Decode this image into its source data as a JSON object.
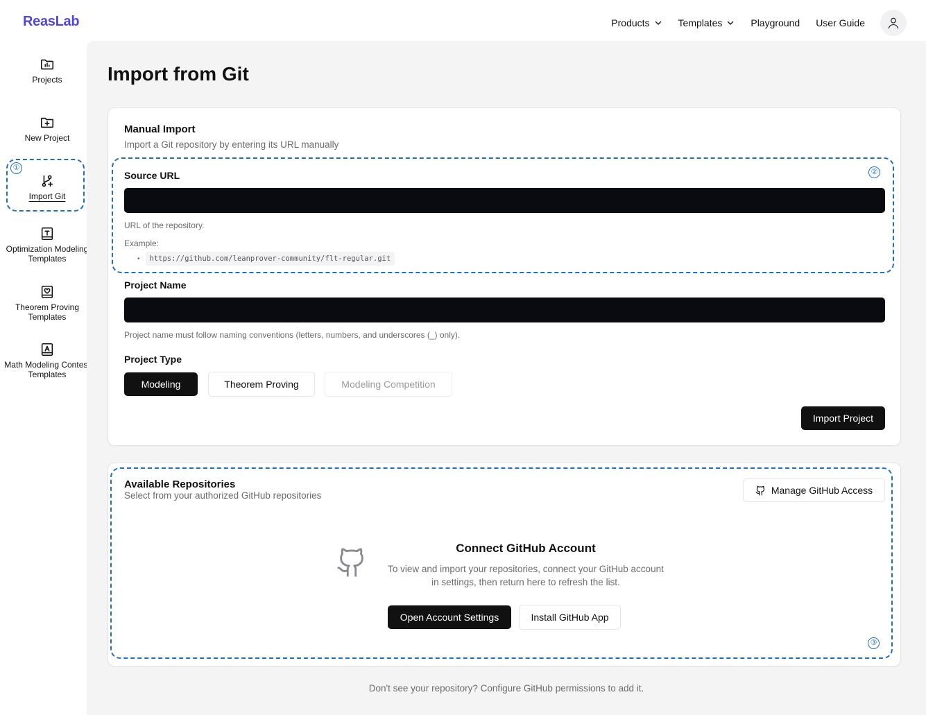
{
  "brand": {
    "logo": "ReasLab",
    "color": "#5147e0"
  },
  "topnav": {
    "products": "Products",
    "templates": "Templates",
    "playground": "Playground",
    "user_guide": "User Guide"
  },
  "sidebar": {
    "items": [
      {
        "label": "Projects",
        "icon": "folder-chart-icon"
      },
      {
        "label": "New Project",
        "icon": "folder-plus-icon"
      },
      {
        "label": "Import Git",
        "icon": "git-branch-plus-icon",
        "active": true
      },
      {
        "label": "Optimization Modeling Templates",
        "icon": "book-text-icon"
      },
      {
        "label": "Theorem Proving Templates",
        "icon": "book-heart-icon"
      },
      {
        "label": "Math Modeling Contest Templates",
        "icon": "book-a-icon"
      }
    ]
  },
  "annotations": {
    "one": "①",
    "two": "②",
    "three": "③"
  },
  "page": {
    "title": "Import from Git"
  },
  "manual": {
    "title": "Manual Import",
    "subtitle": "Import a Git repository by entering its URL manually",
    "source_label": "Source URL",
    "source_value": "",
    "source_help": "URL of the repository.",
    "example_label": "Example:",
    "example_bullet": "•",
    "example_url": "https://github.com/leanprover-community/flt-regular.git",
    "name_label": "Project Name",
    "name_value": "",
    "name_help": "Project name must follow naming conventions (letters, numbers, and underscores (_) only).",
    "type_label": "Project Type",
    "types": [
      "Modeling",
      "Theorem Proving",
      "Modeling Competition"
    ],
    "selected_type": "Modeling",
    "import_button": "Import Project"
  },
  "repos": {
    "title": "Available Repositories",
    "subtitle": "Select from your authorized GitHub repositories",
    "manage_button": "Manage GitHub Access",
    "connect_title": "Connect GitHub Account",
    "connect_line1": "To view and import your repositories, connect your GitHub account",
    "connect_line2": "in settings, then return here to refresh the list.",
    "open_settings": "Open Account Settings",
    "install_app": "Install GitHub App"
  },
  "footer": {
    "note": "Don't see your repository? Configure GitHub permissions to add it."
  }
}
